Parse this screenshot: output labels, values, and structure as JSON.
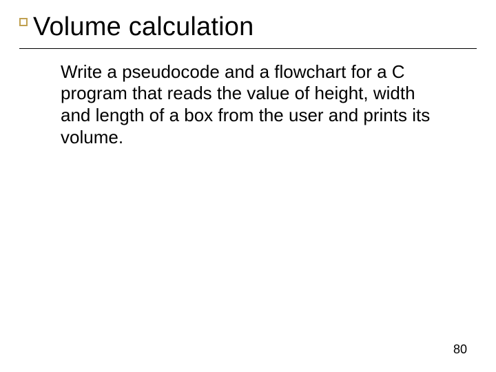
{
  "slide": {
    "title": "Volume calculation",
    "body": "Write a pseudocode and a flowchart for a C program that reads the value of height, width and length of a box from the user and prints its volume.",
    "page_number": "80"
  }
}
